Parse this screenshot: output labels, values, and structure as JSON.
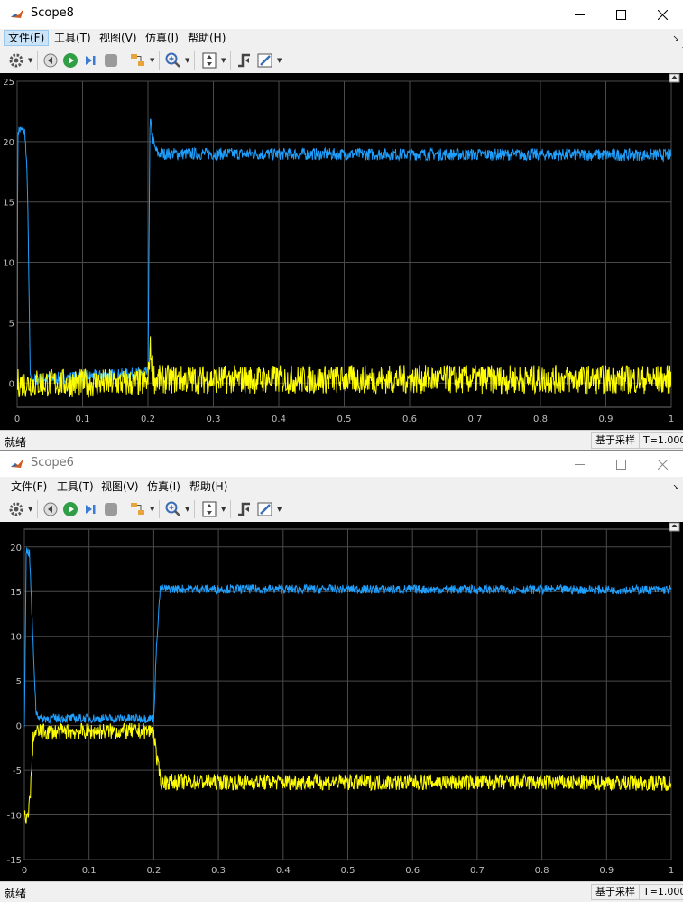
{
  "windows": [
    {
      "title": "Scope8",
      "menu": [
        "文件(F)",
        "工具(T)",
        "视图(V)",
        "仿真(I)",
        "帮助(H)"
      ],
      "status": "就绪",
      "sample_mode": "基于采样",
      "time": "T=1.000",
      "chart_data": {
        "type": "line",
        "xlim": [
          0,
          1
        ],
        "ylim": [
          -2,
          25
        ],
        "xticks": [
          "0",
          "0.1",
          "0.2",
          "0.3",
          "0.4",
          "0.5",
          "0.6",
          "0.7",
          "0.8",
          "0.9",
          "1"
        ],
        "yticks": [
          0,
          5,
          10,
          15,
          20,
          25
        ],
        "ytick_labels": [
          "0",
          "5",
          "10",
          "15",
          "20",
          "25"
        ],
        "grid": true,
        "background": "#000000",
        "series": [
          {
            "color": "#1fa0ff",
            "noise": 0.5,
            "segments": [
              [
                0,
                0
              ],
              [
                0.001,
                21
              ],
              [
                0.012,
                20.8
              ],
              [
                0.016,
                16
              ],
              [
                0.02,
                0.3
              ],
              [
                0.19,
                0.8
              ],
              [
                0.2,
                0.8
              ],
              [
                0.203,
                21.8
              ],
              [
                0.21,
                19.5
              ],
              [
                0.215,
                19
              ],
              [
                1,
                18.9
              ]
            ]
          },
          {
            "color": "#ffff00",
            "noise": 1.2,
            "segments": [
              [
                0,
                0
              ],
              [
                0.02,
                0
              ],
              [
                0.2,
                0
              ],
              [
                0.203,
                3
              ],
              [
                0.21,
                0.3
              ],
              [
                1,
                0.3
              ]
            ]
          }
        ]
      }
    },
    {
      "title": "Scope6",
      "menu": [
        "文件(F)",
        "工具(T)",
        "视图(V)",
        "仿真(I)",
        "帮助(H)"
      ],
      "status": "就绪",
      "sample_mode": "基于采样",
      "time": "T=1.000",
      "chart_data": {
        "type": "line",
        "xlim": [
          0,
          1
        ],
        "ylim": [
          -15,
          22
        ],
        "xticks": [
          "0",
          "0.1",
          "0.2",
          "0.3",
          "0.4",
          "0.5",
          "0.6",
          "0.7",
          "0.8",
          "0.9",
          "1"
        ],
        "yticks": [
          -15,
          -10,
          -5,
          0,
          5,
          10,
          15,
          20
        ],
        "ytick_labels": [
          "-15",
          "-10",
          "-5",
          "0",
          "5",
          "10",
          "15",
          "20"
        ],
        "grid": true,
        "background": "#000000",
        "series": [
          {
            "color": "#1fa0ff",
            "noise": 0.5,
            "segments": [
              [
                0,
                0
              ],
              [
                0.003,
                19.8
              ],
              [
                0.008,
                19.2
              ],
              [
                0.013,
                10
              ],
              [
                0.018,
                1.5
              ],
              [
                0.025,
                0.8
              ],
              [
                0.2,
                0.8
              ],
              [
                0.205,
                10
              ],
              [
                0.21,
                15.3
              ],
              [
                1,
                15.2
              ]
            ]
          },
          {
            "color": "#ffff00",
            "noise": 0.9,
            "segments": [
              [
                0,
                -10
              ],
              [
                0.003,
                -11
              ],
              [
                0.009,
                -8
              ],
              [
                0.014,
                -1
              ],
              [
                0.02,
                -0.7
              ],
              [
                0.2,
                -0.6
              ],
              [
                0.205,
                -4
              ],
              [
                0.212,
                -6.3
              ],
              [
                1,
                -6.4
              ]
            ]
          }
        ]
      }
    }
  ]
}
